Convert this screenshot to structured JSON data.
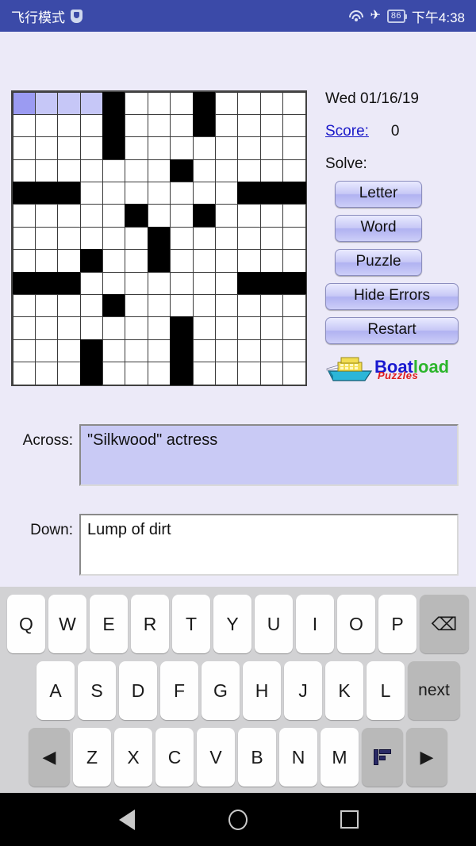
{
  "status_bar": {
    "mode_label": "飞行模式",
    "shield_icon": "shield-icon",
    "wifi_icon": "wifi-icon",
    "airplane_icon": "airplane-icon",
    "battery_level": "86",
    "time": "下午4:38"
  },
  "puzzle": {
    "date": "Wed 01/16/19",
    "score_label": "Score:",
    "score_value": "0",
    "solve_label": "Solve:",
    "buttons": {
      "letter": "Letter",
      "word": "Word",
      "puzzle": "Puzzle",
      "hide_errors": "Hide Errors",
      "restart": "Restart"
    },
    "logo": {
      "part1": "Boat",
      "part2": "load",
      "subtitle": "Puzzles"
    },
    "grid": {
      "columns": 13,
      "rows": 13,
      "cursor": {
        "row": 0,
        "col": 0
      },
      "highlighted": [
        [
          0,
          1
        ],
        [
          0,
          2
        ],
        [
          0,
          3
        ]
      ],
      "black_cells": [
        [
          0,
          4
        ],
        [
          0,
          8
        ],
        [
          1,
          4
        ],
        [
          1,
          8
        ],
        [
          2,
          4
        ],
        [
          3,
          7
        ],
        [
          4,
          0
        ],
        [
          4,
          1
        ],
        [
          4,
          2
        ],
        [
          4,
          10
        ],
        [
          4,
          11
        ],
        [
          4,
          12
        ],
        [
          5,
          5
        ],
        [
          5,
          8
        ],
        [
          6,
          6
        ],
        [
          7,
          3
        ],
        [
          7,
          6
        ],
        [
          8,
          0
        ],
        [
          8,
          1
        ],
        [
          8,
          2
        ],
        [
          8,
          10
        ],
        [
          8,
          11
        ],
        [
          8,
          12
        ],
        [
          9,
          4
        ],
        [
          10,
          7
        ],
        [
          11,
          3
        ],
        [
          11,
          7
        ],
        [
          12,
          3
        ],
        [
          12,
          7
        ]
      ]
    },
    "clues": {
      "across_label": "Across:",
      "across_text": "\"Silkwood\" actress",
      "down_label": "Down:",
      "down_text": "Lump of dirt"
    }
  },
  "keyboard": {
    "row1": [
      "Q",
      "W",
      "E",
      "R",
      "T",
      "Y",
      "U",
      "I",
      "O",
      "P"
    ],
    "backspace_icon": "backspace-icon",
    "row2": [
      "A",
      "S",
      "D",
      "F",
      "G",
      "H",
      "J",
      "K",
      "L"
    ],
    "next_label": "next",
    "row3": [
      "Z",
      "X",
      "C",
      "V",
      "B",
      "N",
      "M"
    ],
    "left_arrow_icon": "arrow-left-icon",
    "right_arrow_icon": "arrow-right-icon",
    "switch_icon": "keyboard-switch-icon"
  },
  "nav_bar": {
    "back_icon": "back-triangle-icon",
    "home_icon": "home-circle-icon",
    "recents_icon": "recents-square-icon"
  }
}
